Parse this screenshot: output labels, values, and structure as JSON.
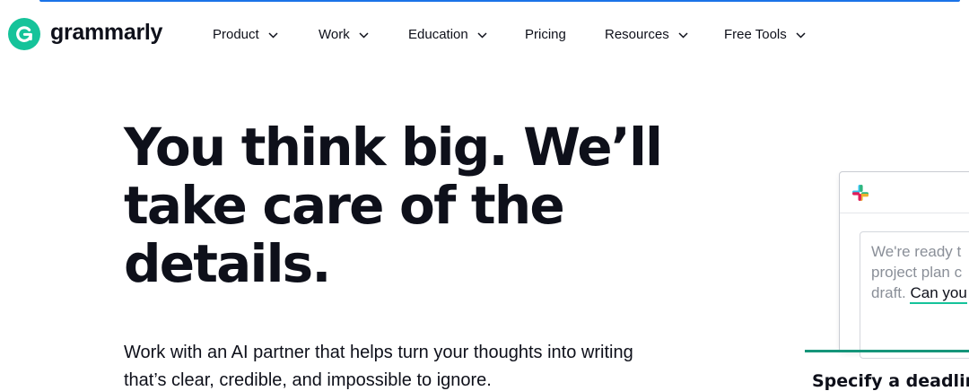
{
  "brand": {
    "name": "grammarly",
    "accent_color": "#15c39a",
    "icon": "grammarly-g-logo"
  },
  "nav": {
    "items": [
      {
        "label": "Product",
        "has_dropdown": true
      },
      {
        "label": "Work",
        "has_dropdown": true
      },
      {
        "label": "Education",
        "has_dropdown": true
      },
      {
        "label": "Pricing",
        "has_dropdown": false
      },
      {
        "label": "Resources",
        "has_dropdown": true
      },
      {
        "label": "Free Tools",
        "has_dropdown": true
      }
    ],
    "dropdown_icon": "chevron-down-icon"
  },
  "hero": {
    "title_line1": "You think big. We’ll",
    "title_line2": "take care of the",
    "title_line3": "details.",
    "subtitle_line1": "Work with an AI partner that helps turn your thoughts into writing",
    "subtitle_line2": "that’s clear, credible, and impossible to ignore."
  },
  "preview": {
    "app_icon": "slack-icon",
    "message_line1": "We're ready t",
    "message_line2": "project plan c",
    "message_line3_plain": "draft.",
    "message_line3_highlight": "Can you",
    "highlight_color": "#15c39a",
    "caption": "Specify a deadlin"
  }
}
